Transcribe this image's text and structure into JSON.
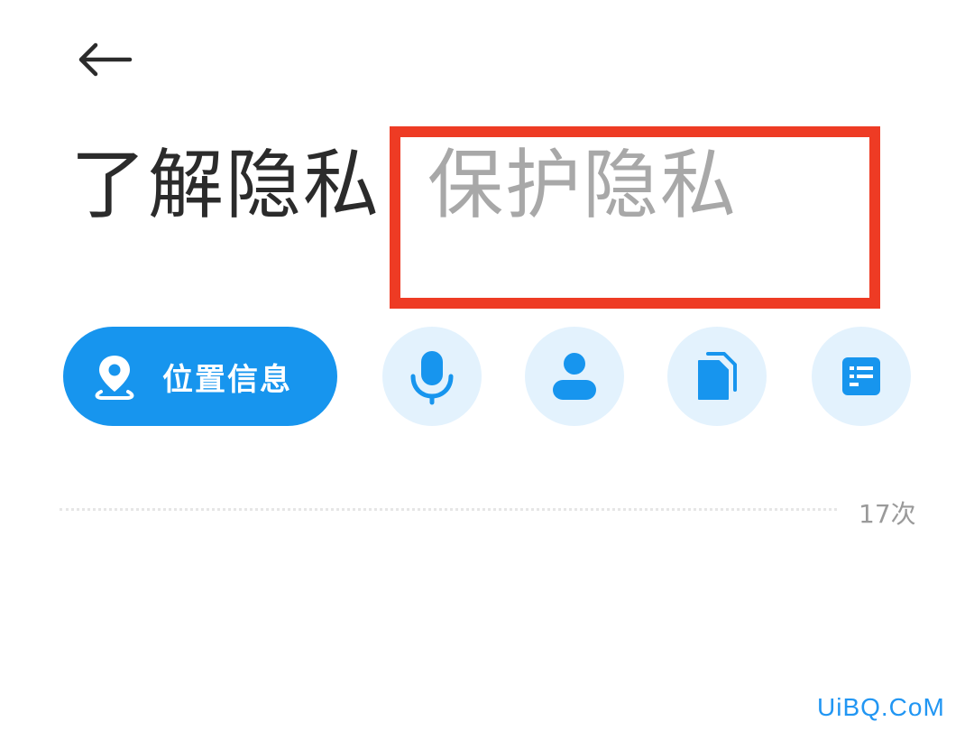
{
  "header": {
    "back_icon": "arrow-left-icon"
  },
  "tabs": [
    {
      "label": "了解隐私",
      "active": true
    },
    {
      "label": "保护隐私",
      "active": false
    }
  ],
  "categories": {
    "selected": {
      "label": "位置信息",
      "icon": "location-pin-icon"
    },
    "others": [
      {
        "icon": "microphone-icon"
      },
      {
        "icon": "contact-person-icon"
      },
      {
        "icon": "files-icon"
      },
      {
        "icon": "list-document-icon"
      }
    ]
  },
  "usage": {
    "count": "17次"
  },
  "watermark": "UiBQ.CoM",
  "colors": {
    "accent": "#1795ee",
    "chip_bg": "#e3f2fd",
    "highlight": "#ee3b24",
    "tab_active": "#2b2b2b",
    "tab_inactive": "#a8a8a8"
  }
}
